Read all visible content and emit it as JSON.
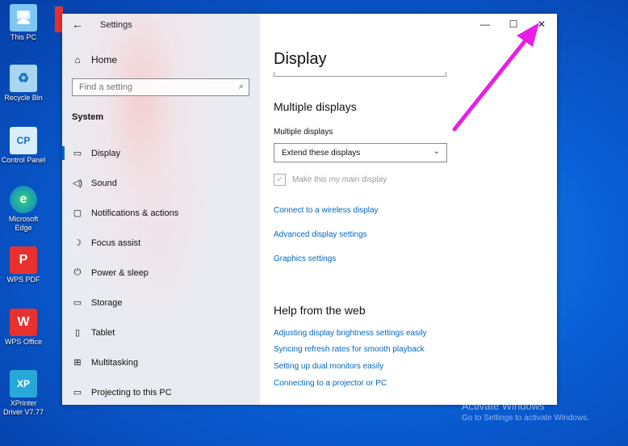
{
  "desktop": {
    "icons": [
      {
        "label": "This PC",
        "icon": "this-pc-icon"
      },
      {
        "label": "Recycle Bin",
        "icon": "recycle-bin-icon"
      },
      {
        "label": "Control Panel",
        "icon": "control-panel-icon"
      },
      {
        "label": "Microsoft Edge",
        "icon": "edge-icon"
      },
      {
        "label": "WPS PDF",
        "icon": "wps-pdf-icon"
      },
      {
        "label": "WPS Office",
        "icon": "wps-office-icon"
      },
      {
        "label": "XPrinter Driver V7.77",
        "icon": "xprinter-icon"
      }
    ]
  },
  "window": {
    "title": "Settings",
    "home": "Home",
    "search_placeholder": "Find a setting",
    "section": "System",
    "nav": [
      {
        "label": "Display",
        "icon": "monitor-icon",
        "glyph": "▭"
      },
      {
        "label": "Sound",
        "icon": "speaker-icon",
        "glyph": "◁)"
      },
      {
        "label": "Notifications & actions",
        "icon": "notifications-icon",
        "glyph": "▢"
      },
      {
        "label": "Focus assist",
        "icon": "moon-icon",
        "glyph": "☽"
      },
      {
        "label": "Power & sleep",
        "icon": "power-icon",
        "glyph": "⏻"
      },
      {
        "label": "Storage",
        "icon": "storage-icon",
        "glyph": "▭"
      },
      {
        "label": "Tablet",
        "icon": "tablet-icon",
        "glyph": "▯"
      },
      {
        "label": "Multitasking",
        "icon": "multitasking-icon",
        "glyph": "⊞"
      },
      {
        "label": "Projecting to this PC",
        "icon": "projecting-icon",
        "glyph": "▭"
      }
    ],
    "content": {
      "title": "Display",
      "multiple_heading": "Multiple displays",
      "multiple_label": "Multiple displays",
      "dropdown_value": "Extend these displays",
      "main_display_label": "Make this my main display",
      "links": [
        "Connect to a wireless display",
        "Advanced display settings",
        "Graphics settings"
      ],
      "help_heading": "Help from the web",
      "help_links": [
        "Adjusting display brightness settings easily",
        "Syncing refresh rates for smooth playback",
        "Setting up dual monitors easily",
        "Connecting to a projector or PC"
      ]
    }
  },
  "watermark": {
    "line1": "Activate Windows",
    "line2": "Go to Settings to activate Windows."
  },
  "colors": {
    "accent": "#0067c0",
    "annotation_arrow": "#e81ee8"
  }
}
